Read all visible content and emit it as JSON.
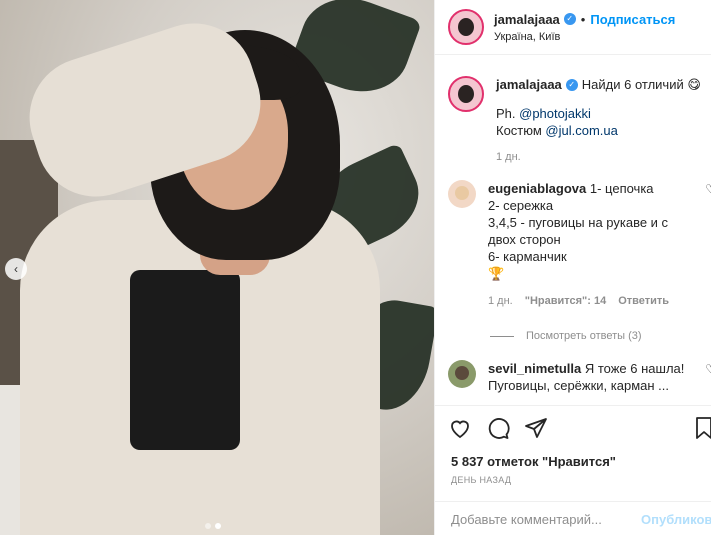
{
  "post": {
    "username": "jamalajaaa",
    "follow_label": "Подписаться",
    "location": "Україна, Київ",
    "dot": "•"
  },
  "caption": {
    "username": "jamalajaaa",
    "text": "Найди 6 отличий 😋",
    "line2_prefix": "Ph. ",
    "line2_link": "@photojakki",
    "line3_prefix": "Костюм ",
    "line3_link": "@jul.com.ua",
    "time": "1 дн."
  },
  "comments": [
    {
      "username": "eugeniablagova",
      "lines": [
        "1- цепочка",
        "2- сережка",
        "3,4,5 - пуговицы на рукаве и с двох сторон",
        "6- карманчик",
        "🏆"
      ],
      "time": "1 дн.",
      "likes": "\"Нравится\": 14",
      "reply": "Ответить",
      "view_replies": "Посмотреть ответы (3)"
    },
    {
      "username": "sevil_nimetulla",
      "text": "Я тоже 6 нашла! Пуговицы, серёжки, карман ..."
    }
  ],
  "actions": {
    "likes_count": "5 837 отметок \"Нравится\"",
    "posted_ago": "ДЕНЬ НАЗАД"
  },
  "comment_box": {
    "placeholder": "Добавьте комментарий...",
    "publish_label": "Опубликовать"
  },
  "icons": {
    "like": "heart-icon",
    "comment": "comment-icon",
    "share": "share-icon",
    "save": "bookmark-icon",
    "prev": "chevron-left-icon",
    "verified": "verified-badge-icon"
  },
  "colors": {
    "accent": "#0095f6",
    "verified": "#3897f0",
    "muted": "#8e8e8e"
  },
  "carousel": {
    "current_index": 2,
    "total": 2
  }
}
